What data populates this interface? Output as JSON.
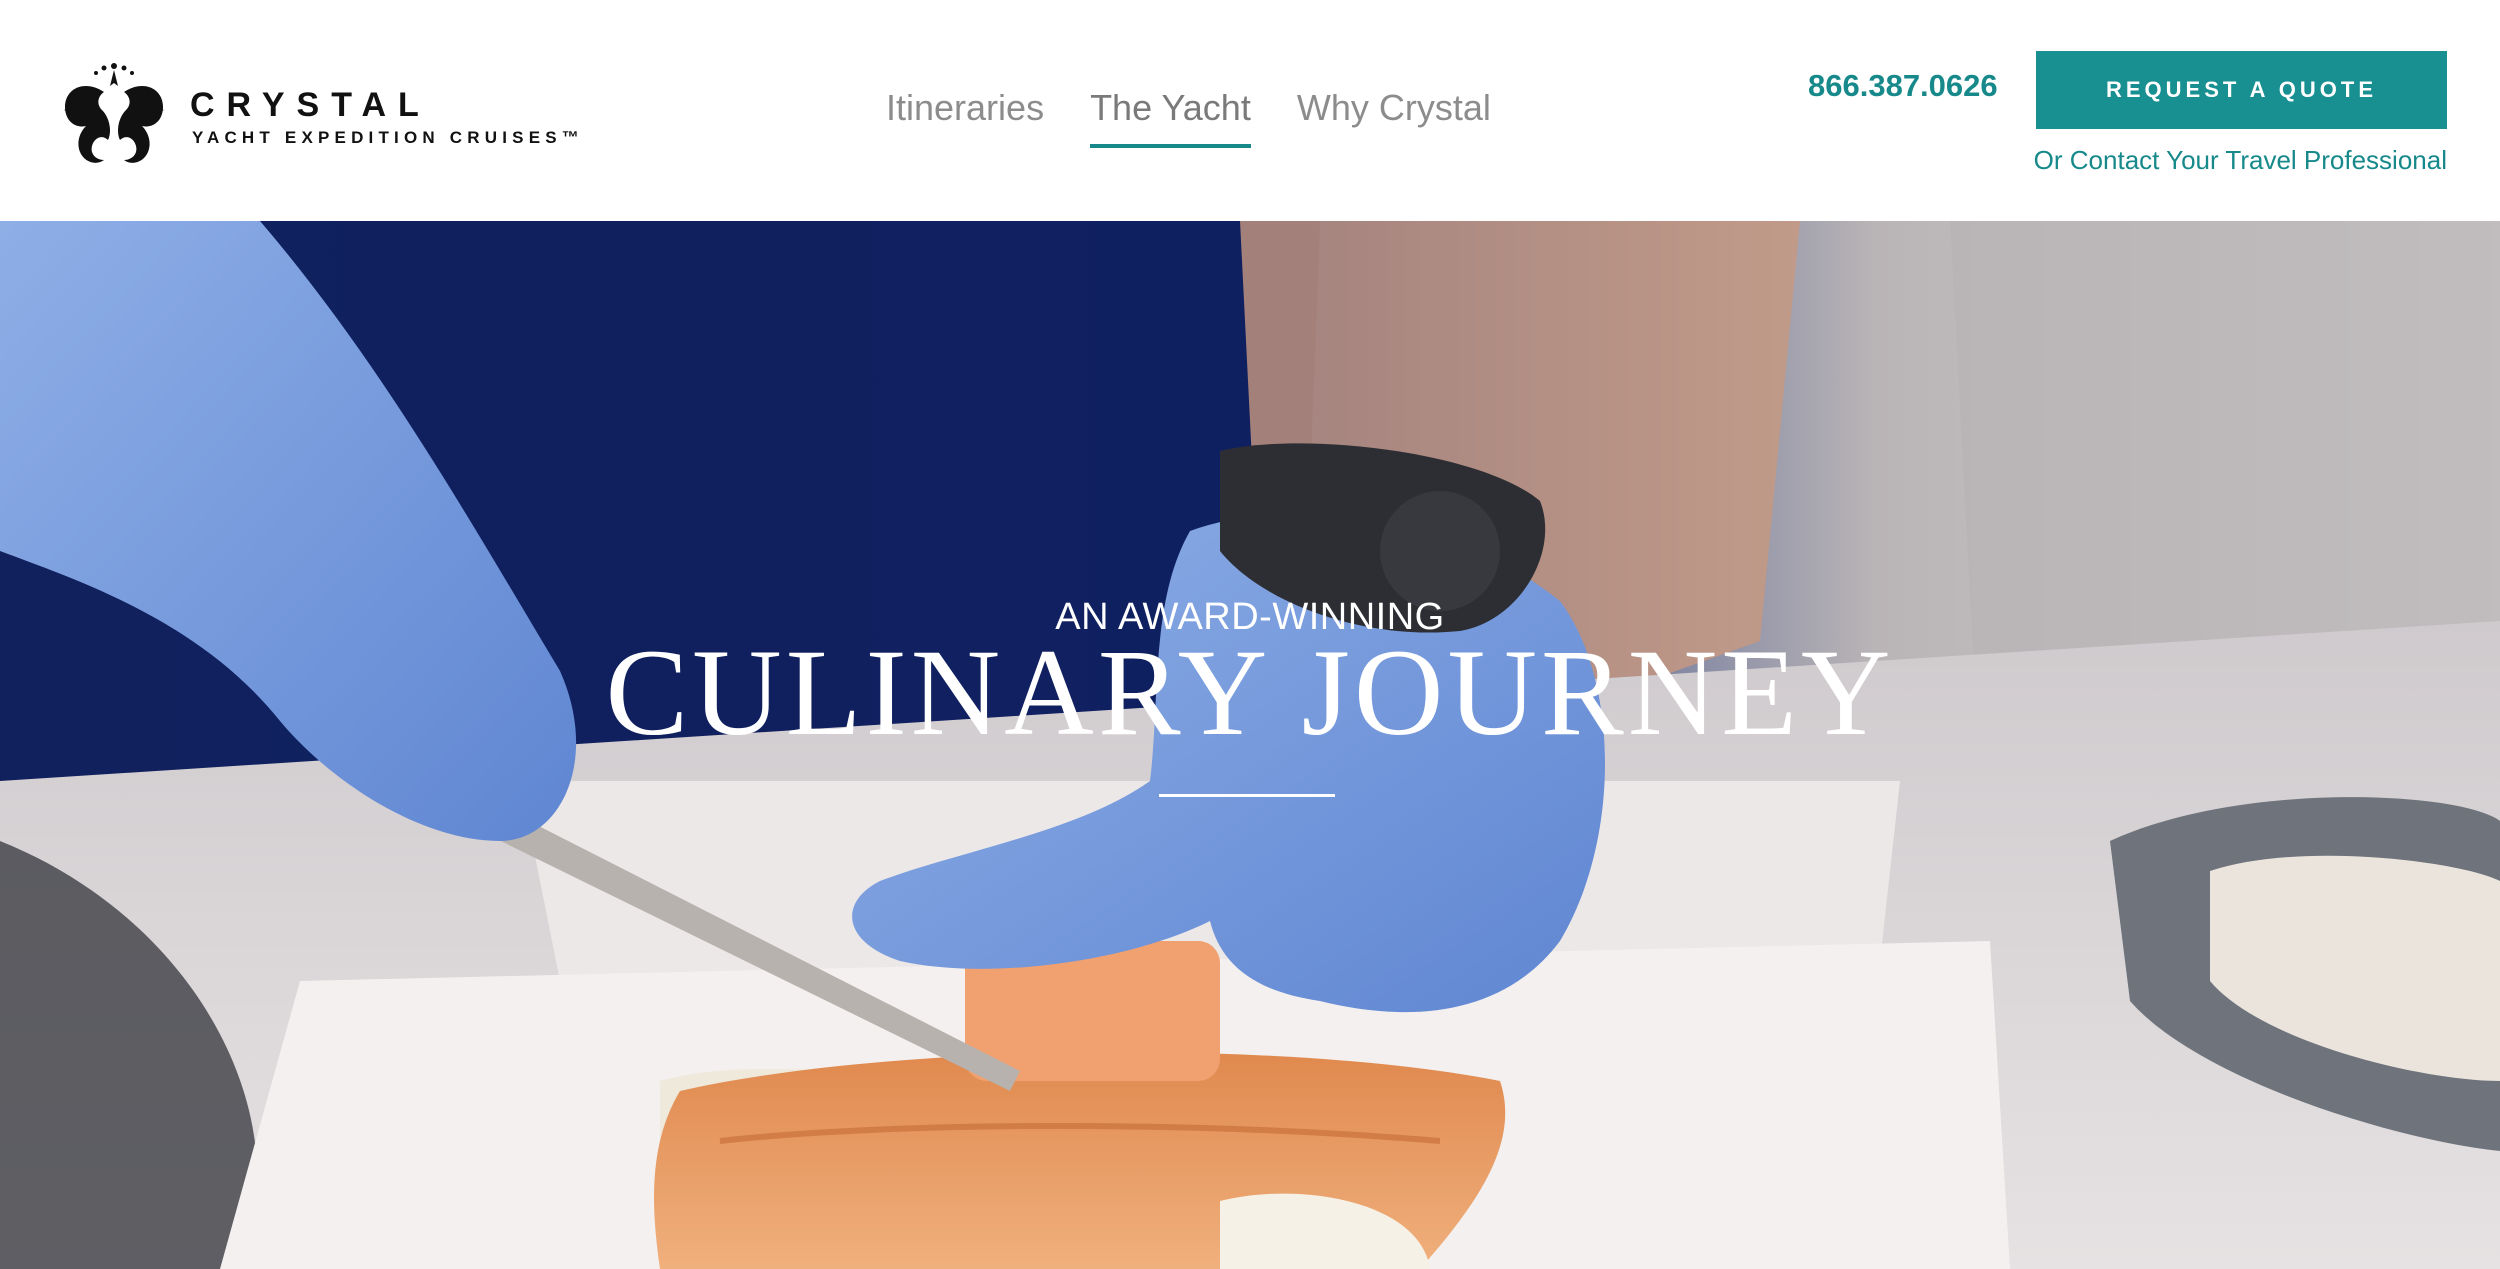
{
  "brand": {
    "name": "CRYSTAL",
    "tagline": "YACHT EXPEDITION CRUISES™",
    "logo_icon": "seahorse-crest-icon"
  },
  "nav": {
    "items": [
      {
        "label": "Itineraries",
        "active": false
      },
      {
        "label": "The Yacht",
        "active": true
      },
      {
        "label": "Why Crystal",
        "active": false
      }
    ]
  },
  "contact": {
    "phone": "866.387.0626",
    "quote_button": "REQUEST A QUOTE",
    "travel_pro_link": "Or Contact Your Travel Professional"
  },
  "hero": {
    "eyebrow": "AN AWARD-WINNING",
    "headline": "CULINARY JOURNEY"
  },
  "colors": {
    "accent": "#188f90",
    "header_bg": "#ffffff",
    "nav_text": "#8c8c8c",
    "hero_text": "#ffffff"
  }
}
